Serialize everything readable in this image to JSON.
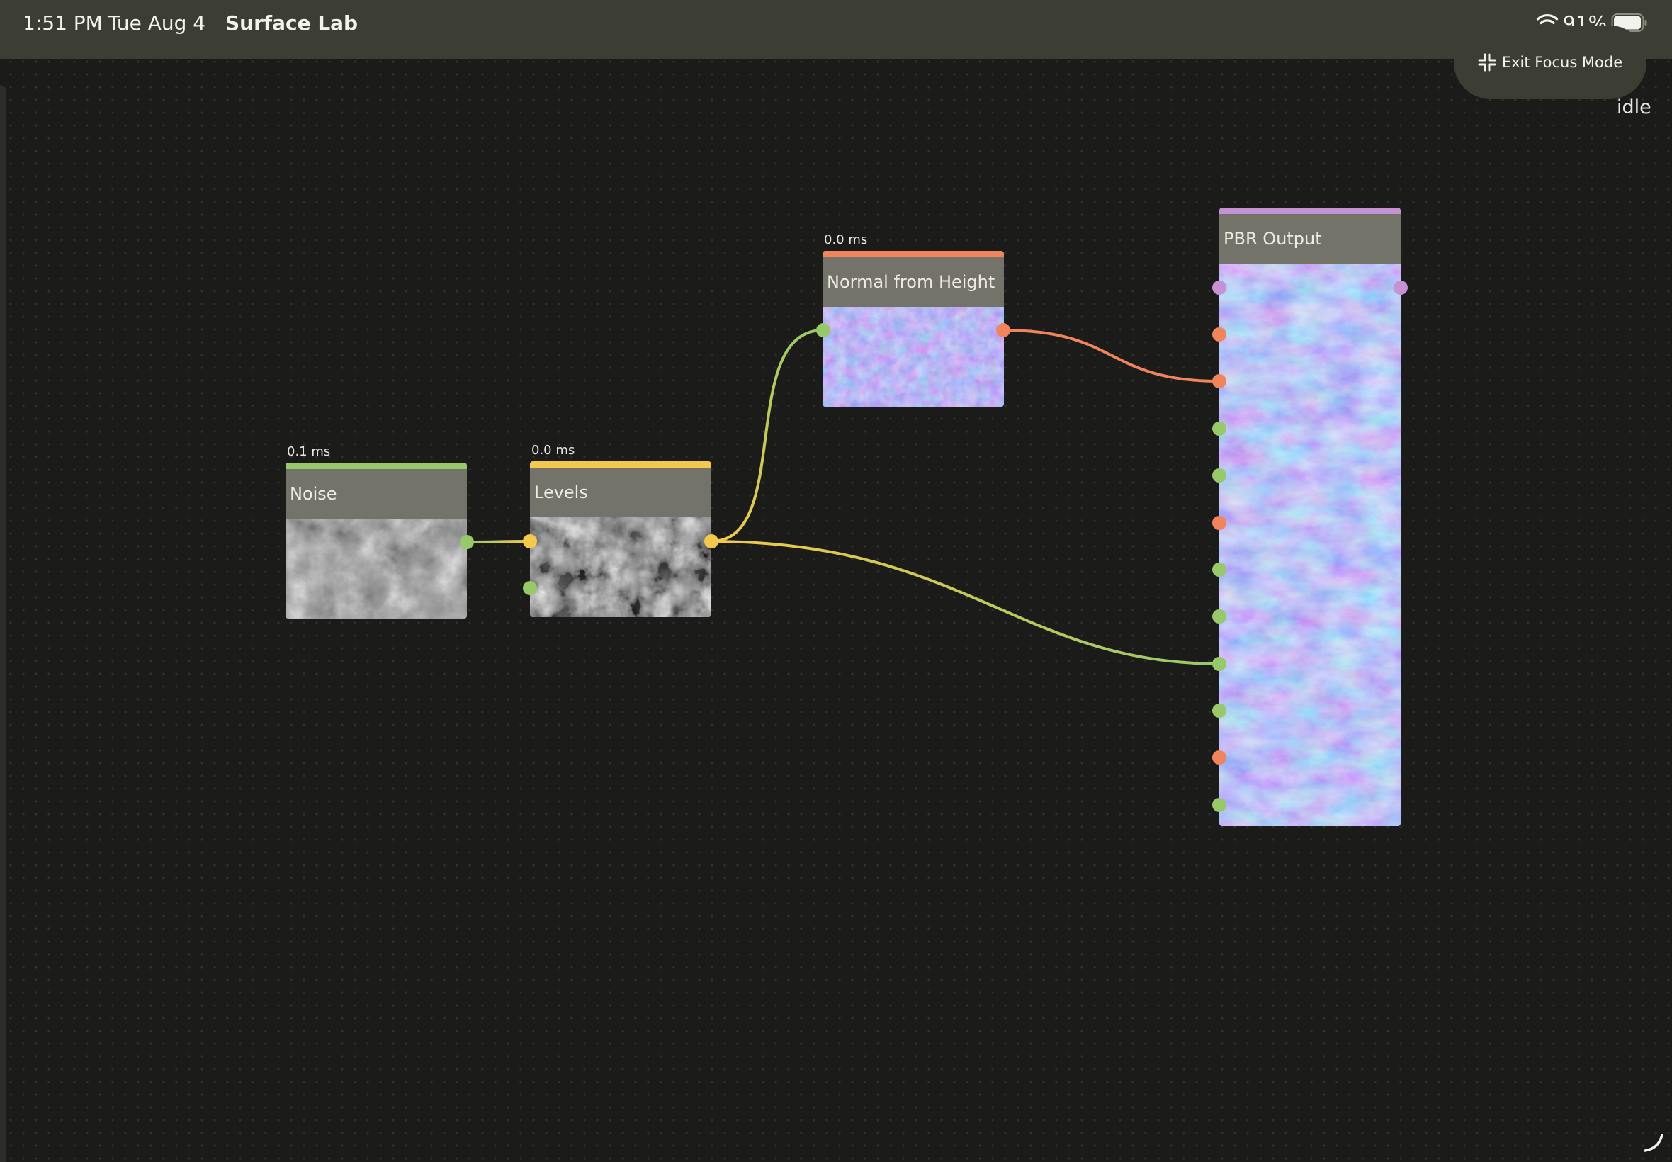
{
  "status_bar": {
    "time": "1:51 PM",
    "date": "Tue Aug 4",
    "battery": "91%",
    "wifi_icon": "wifi-icon",
    "battery_icon": "battery-icon"
  },
  "app": {
    "title": "Surface Lab"
  },
  "toolbar": {
    "exit_focus_label": "Exit Focus Mode",
    "exit_focus_icon": "collapse-icon"
  },
  "status": {
    "state": "idle"
  },
  "colors": {
    "topbar": "#3c3e33",
    "canvas": "#1b1b1a",
    "node_header": "#737369",
    "green_port": "#97c96a",
    "yellow_port": "#f2c94c",
    "orange_port": "#f0845c",
    "purple_port": "#c592d4"
  },
  "nodes": {
    "noise": {
      "title": "Noise",
      "time": "0.1 ms",
      "accent": "#97c96a"
    },
    "levels": {
      "title": "Levels",
      "time": "0.0 ms",
      "accent": "#f2c94c"
    },
    "normal": {
      "title": "Normal from Height",
      "time": "0.0 ms",
      "accent": "#f0845c"
    },
    "pbr": {
      "title": "PBR Output",
      "accent": "#c592d4"
    }
  }
}
